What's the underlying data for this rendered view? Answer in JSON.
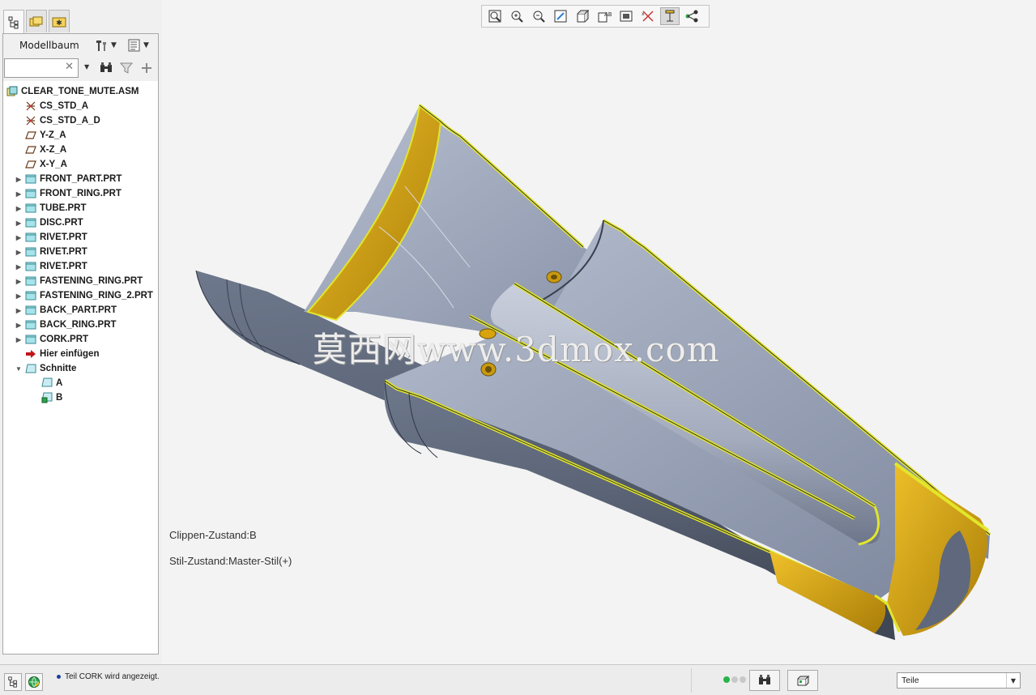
{
  "navigator": {
    "tabs": [
      {
        "name": "model-tree-tab-icon"
      },
      {
        "name": "folder-browser-tab-icon"
      },
      {
        "name": "favorites-tab-icon"
      }
    ]
  },
  "tree_panel": {
    "title": "Modellbaum",
    "search_value": "",
    "root": "CLEAR_TONE_MUTE.ASM",
    "items": [
      {
        "label": "CS_STD_A",
        "icon": "coordinate-system-icon"
      },
      {
        "label": "CS_STD_A_D",
        "icon": "coordinate-system-icon"
      },
      {
        "label": "Y-Z_A",
        "icon": "datum-plane-icon"
      },
      {
        "label": "X-Z_A",
        "icon": "datum-plane-icon"
      },
      {
        "label": "X-Y_A",
        "icon": "datum-plane-icon"
      },
      {
        "label": "FRONT_PART.PRT",
        "icon": "part-icon"
      },
      {
        "label": "FRONT_RING.PRT",
        "icon": "part-icon"
      },
      {
        "label": "TUBE.PRT",
        "icon": "part-icon"
      },
      {
        "label": "DISC.PRT",
        "icon": "part-icon"
      },
      {
        "label": "RIVET.PRT",
        "icon": "part-icon"
      },
      {
        "label": "RIVET.PRT",
        "icon": "part-icon"
      },
      {
        "label": "RIVET.PRT",
        "icon": "part-icon"
      },
      {
        "label": "FASTENING_RING.PRT",
        "icon": "part-icon"
      },
      {
        "label": "FASTENING_RING_2.PRT",
        "icon": "part-icon"
      },
      {
        "label": "BACK_PART.PRT",
        "icon": "part-icon"
      },
      {
        "label": "BACK_RING.PRT",
        "icon": "part-icon"
      },
      {
        "label": "CORK.PRT",
        "icon": "part-icon"
      },
      {
        "label": "Hier einfügen",
        "icon": "insert-here-arrow-icon"
      },
      {
        "label": "Schnitte",
        "icon": "sections-folder-icon"
      },
      {
        "label": "A",
        "icon": "section-icon"
      },
      {
        "label": "B",
        "icon": "active-section-icon"
      }
    ]
  },
  "viewport": {
    "toolbar": [
      "refit-icon",
      "zoom-in-icon",
      "zoom-out-icon",
      "repaint-icon",
      "display-style-icon",
      "saved-orientations-icon",
      "view-manager-icon",
      "datum-display-icon",
      "annotation-display-icon",
      "spin-center-icon"
    ],
    "clipping_state": "Clippen-Zustand:B",
    "style_state": "Stil-Zustand:Master-Stil(+)",
    "watermark": "莫西网www.3dmox.com"
  },
  "status_bar": {
    "message": "Teil CORK wird angezeigt.",
    "filter_value": "Teile"
  },
  "colors": {
    "section_edge": "#e2e62a",
    "metal": "#7f8aa0",
    "cork": "#d9a30e"
  }
}
